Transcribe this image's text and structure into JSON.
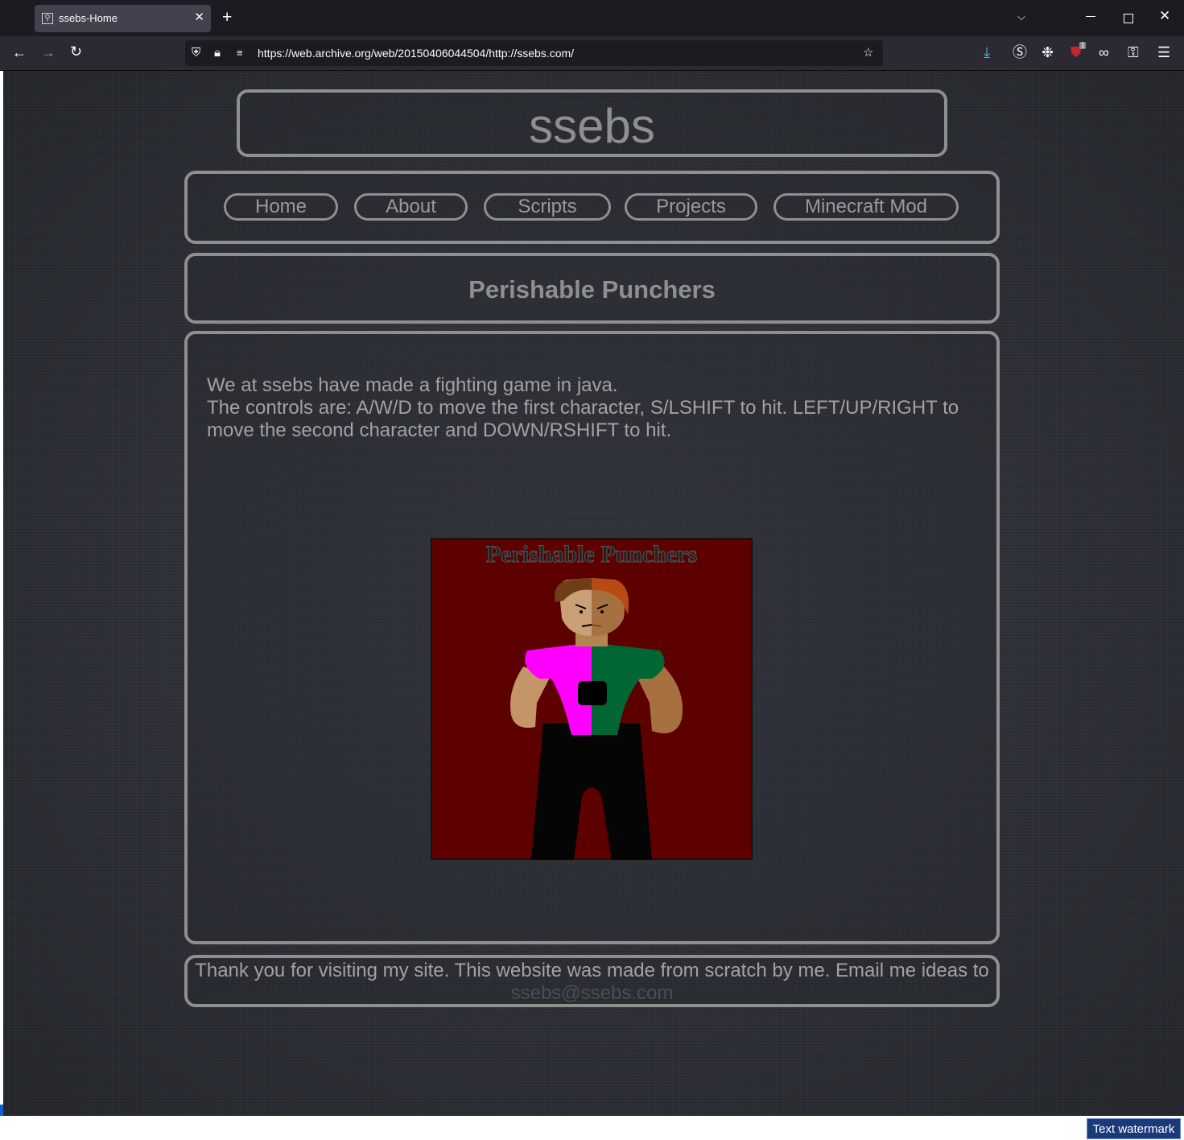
{
  "browser": {
    "tab_title": "ssebs-Home",
    "tab_close": "✕",
    "new_tab": "+",
    "url": "https://web.archive.org/web/20150406044504/http://ssebs.com/"
  },
  "site": {
    "title": "ssebs",
    "nav": [
      "Home",
      "About",
      "Scripts",
      "Projects",
      "Minecraft Mod"
    ],
    "page_heading": "Perishable Punchers",
    "content_lines": [
      "We at ssebs have made a fighting game in java.",
      "The controls are: A/W/D to move the first character, S/LSHIFT to hit. LEFT/UP/RIGHT to move the second character and DOWN/RSHIFT to hit."
    ],
    "image_caption": "Perishable Punchers",
    "footer_text": "Thank you for visiting my site. This website was made from scratch by me. Email me ideas to",
    "footer_email": "ssebs@ssebs.com"
  },
  "overlay": {
    "watermark": "Text watermark"
  },
  "colors": {
    "panel_border": "#8f8f8f",
    "page_background": "#2a2d33",
    "art_background": "#5c0000",
    "shirt_left": "#ff00ff",
    "shirt_right": "#006633"
  }
}
